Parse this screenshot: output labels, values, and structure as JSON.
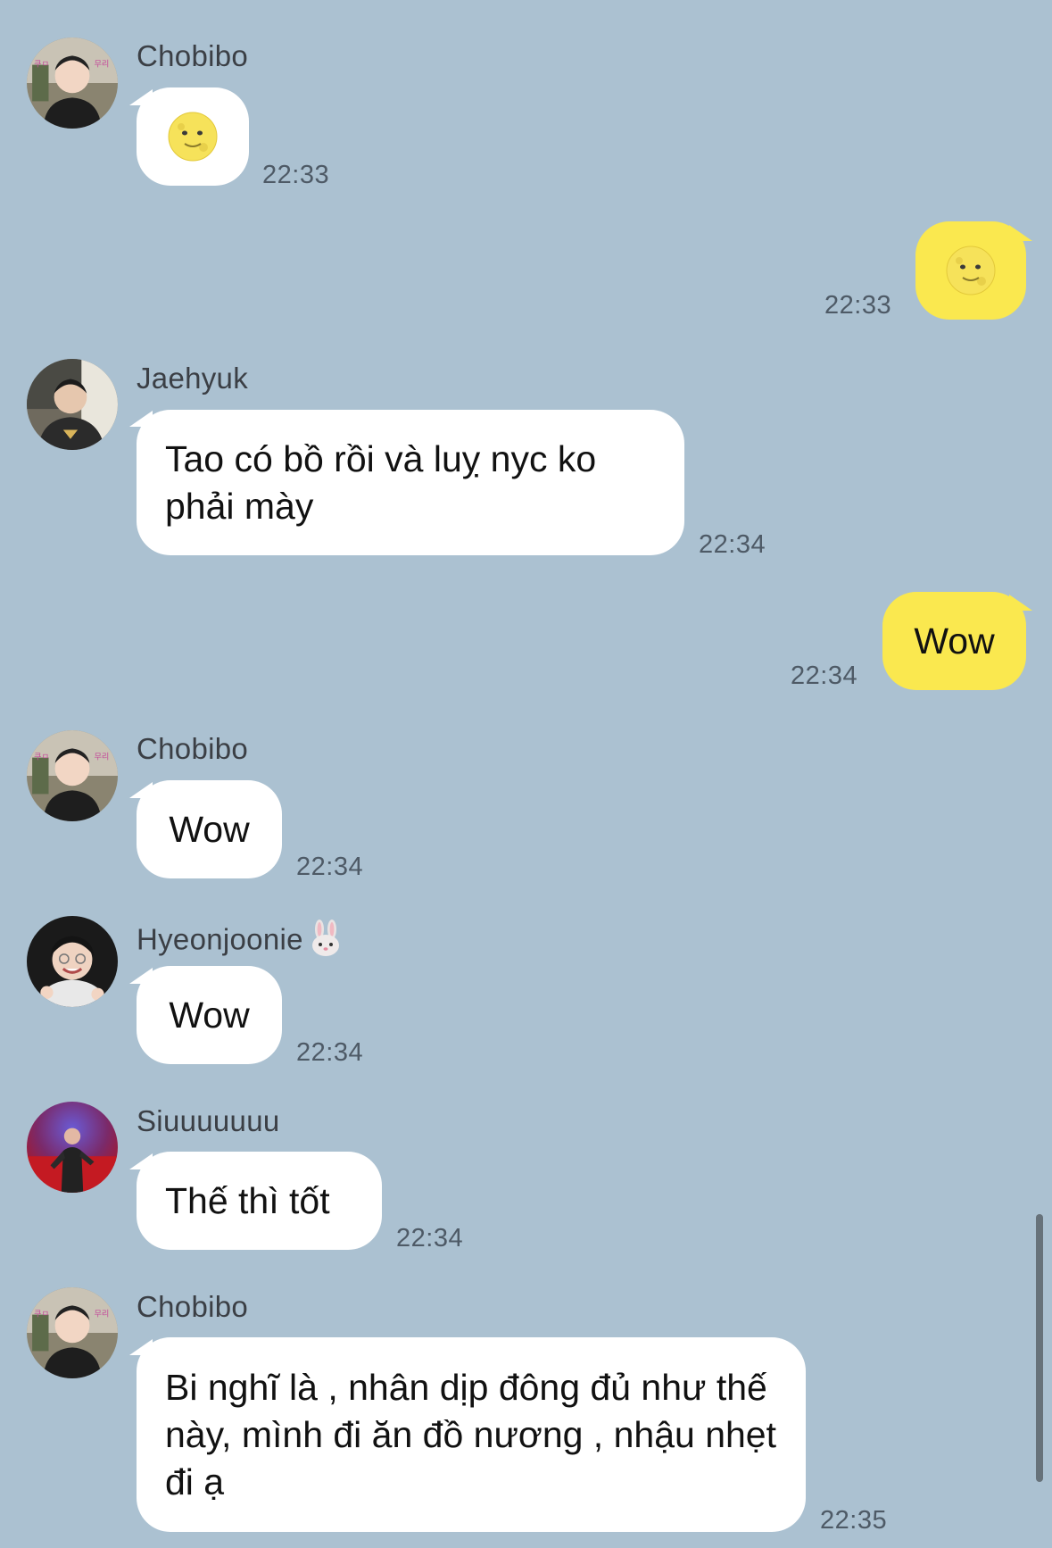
{
  "messages": [
    {
      "sender": "Chobibo",
      "text": "",
      "time": "22:33",
      "emoji": "full-moon-face"
    },
    {
      "sender": "",
      "text": "",
      "time": "22:33",
      "emoji": "full-moon-face"
    },
    {
      "sender": "Jaehyuk",
      "text": "Tao có bồ rồi và luỵ nyc ko phải mày",
      "time": "22:34"
    },
    {
      "sender": "",
      "text": "Wow",
      "time": "22:34"
    },
    {
      "sender": "Chobibo",
      "text": "Wow",
      "time": "22:34"
    },
    {
      "sender": "Hyeonjoonie",
      "text": "Wow",
      "time": "22:34",
      "name_emoji": "rabbit-face"
    },
    {
      "sender": "Siuuuuuuu",
      "text": "Thế thì tốt",
      "time": "22:34"
    },
    {
      "sender": "Chobibo",
      "text": "Bi nghĩ là , nhân dịp đông đủ như thế này, mình đi ăn đồ nương , nhậu nhẹt đi ạ",
      "time": "22:35"
    }
  ],
  "colors": {
    "background": "#abc1d1",
    "incoming_bubble": "#ffffff",
    "outgoing_bubble": "#fae84f"
  }
}
